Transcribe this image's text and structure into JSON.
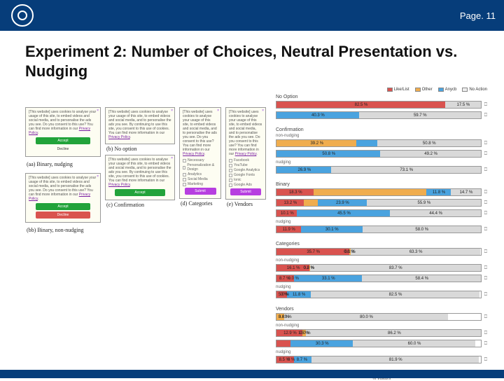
{
  "colors": {
    "brand": "#063d7a",
    "accept": "#22a33a",
    "decline": "#d9534f",
    "purple": "#b73fe0",
    "cat_likelist": "#d9534f",
    "cat_other": "#f0ad4e",
    "cat_anycb": "#4aa3df",
    "cat_noaction": "#d9d9d9"
  },
  "header": {
    "page_label": "Page",
    "page_sep": ".",
    "page_number": "11"
  },
  "title": "Experiment 2: Number of Choices, Neutral Presentation vs. Nudging",
  "cookie_body": "[This website] uses cookies to analyse your usage of this site, to embed videos and social media, and to personalise the ads you see. Do you consent to this use? You can find more information in our",
  "cookie_body_noopt": "[This website] uses cookies to analyse your usage of this site, to embed videos and social media, and to personalise the ads you see. By continuing to use this site, you consent to this use of cookies. You can find more information in our",
  "privacy_link": "Privacy Policy",
  "buttons": {
    "accept": "Accept",
    "decline": "Decline",
    "submit": "Submit"
  },
  "captions": {
    "a": "(aa) Binary, nudging",
    "b": "(b) No option",
    "bb": "(bb) Binary, non-nudging",
    "c": "(c) Confirmation",
    "d": "(d) Categories",
    "e": "(e) Vendors"
  },
  "categories_list": [
    "Necessary",
    "Personalization & Design",
    "Analytics",
    "Social Media",
    "Marketing"
  ],
  "vendors_list": [
    "Facebook",
    "YouTube",
    "Google Analytics",
    "Google Fonts",
    "Ionic",
    "Google Ads"
  ],
  "legend": {
    "likelist": "Like/List",
    "other": "Other",
    "anycb": "Anycb",
    "noaction": "No Action"
  },
  "chart_data": {
    "type": "bar",
    "stacked": true,
    "orientation": "horizontal",
    "xlabel": "% Visitors",
    "xlim": [
      0,
      100
    ],
    "xticks": [
      0,
      25,
      50,
      75,
      100
    ],
    "series_keys": [
      "likelist",
      "other",
      "anycb",
      "noaction"
    ],
    "groups": [
      {
        "name": "No Option",
        "rows": [
          {
            "label": "",
            "values": {
              "likelist": 82.5,
              "other": 0,
              "anycb": 0,
              "noaction": 17.5
            },
            "pct_labels": [
              "82.5 %",
              "",
              "",
              "17.5 %"
            ]
          },
          {
            "label": "",
            "values": {
              "likelist": 0,
              "other": 0,
              "anycb": 40.3,
              "noaction": 59.7
            },
            "pct_labels": [
              "",
              "",
              "40.3 %",
              "59.7 %"
            ]
          }
        ]
      },
      {
        "name": "Confirmation",
        "rows": [
          {
            "label": "non-nudging",
            "values": {
              "likelist": 0,
              "other": 39.2,
              "anycb": 10,
              "noaction": 50.8
            },
            "pct_labels": [
              "",
              "39.2 %",
              "",
              "50.8 %"
            ]
          },
          {
            "label": "",
            "values": {
              "likelist": 0,
              "other": 0,
              "anycb": 50.8,
              "noaction": 49.2
            },
            "pct_labels": [
              "",
              "",
              "50.8 %",
              "49.2 %"
            ]
          },
          {
            "label": "nudging",
            "values": {
              "likelist": 0,
              "other": 0,
              "anycb": 26.9,
              "noaction": 73.1
            },
            "pct_labels": [
              "",
              "",
              "26.9 %",
              "73.1 %"
            ]
          }
        ]
      },
      {
        "name": "Binary",
        "rows": [
          {
            "label": "",
            "values": {
              "likelist": 18.3,
              "other": 55.2,
              "anycb": 11.8,
              "noaction": 14.7
            },
            "pct_labels": [
              "18.3 %",
              "",
              "11.8 %",
              "14.7 %"
            ]
          },
          {
            "label": "",
            "values": {
              "likelist": 13.2,
              "other": 7,
              "anycb": 23.9,
              "noaction": 55.9
            },
            "pct_labels": [
              "13.2 %",
              "",
              "23.9 %",
              "55.9 %"
            ]
          },
          {
            "label": "",
            "values": {
              "likelist": 10.1,
              "other": 0,
              "anycb": 45.5,
              "noaction": 44.4
            },
            "pct_labels": [
              "10.1 %",
              "",
              "45.5 %",
              "44.4 %"
            ]
          },
          {
            "label": "nudging",
            "values": {
              "likelist": 11.9,
              "other": 0,
              "anycb": 30.1,
              "noaction": 58.0
            },
            "pct_labels": [
              "11.9 %",
              "",
              "30.1 %",
              "58.0 %"
            ]
          }
        ]
      },
      {
        "name": "Categories",
        "rows": [
          {
            "label": "",
            "values": {
              "likelist": 35.7,
              "other": 0.6,
              "anycb": 0.1,
              "noaction": 63.3
            },
            "pct_labels": [
              "35.7 %",
              "0.6 %",
              "0.1 %",
              "63.3 %"
            ]
          },
          {
            "label": "non-nudging",
            "values": {
              "likelist": 16.1,
              "other": 0.2,
              "anycb": 0.0,
              "noaction": 83.7
            },
            "pct_labels": [
              "16.1 %",
              "0.2 %",
              "0.0 %",
              "83.7 %"
            ]
          },
          {
            "label": "",
            "values": {
              "likelist": 8.7,
              "other": 0.0,
              "anycb": 33.1,
              "noaction": 58.4
            },
            "pct_labels": [
              "8.7 %",
              "0.0 %",
              "33.1 %",
              "58.4 %"
            ]
          },
          {
            "label": "nudging",
            "values": {
              "likelist": 5.0,
              "other": 0,
              "anycb": 11.8,
              "noaction": 82.5
            },
            "pct_labels": [
              "5.0 %",
              "0 %",
              "11.8 %",
              "82.5 %"
            ]
          }
        ]
      },
      {
        "name": "Vendors",
        "rows": [
          {
            "label": "",
            "values": {
              "likelist": 0,
              "other": 3.8,
              "anycb": 0.03,
              "noaction": 80.0
            },
            "pct_labels": [
              "",
              "3.8 %",
              "0.03 %",
              "80.0 %"
            ]
          },
          {
            "label": "non-nudging",
            "values": {
              "likelist": 12.9,
              "other": 1.5,
              "anycb": 0.0,
              "noaction": 86.2
            },
            "pct_labels": [
              "12.9 %",
              "1.5 %",
              "0.0 %",
              "86.2 %"
            ]
          },
          {
            "label": "",
            "values": {
              "likelist": 7,
              "other": 0,
              "anycb": 30.3,
              "noaction": 60.0
            },
            "pct_labels": [
              "",
              "",
              "30.3 %",
              "60.0 %"
            ]
          },
          {
            "label": "nudging",
            "values": {
              "likelist": 8.5,
              "other": 0,
              "anycb": 8.7,
              "noaction": 81.9
            },
            "pct_labels": [
              "8.5 %",
              "0 %",
              "8.7 %",
              "81.9 %"
            ]
          }
        ]
      }
    ]
  },
  "axis_ticks": [
    "0",
    "25",
    "50",
    "75",
    "100"
  ]
}
